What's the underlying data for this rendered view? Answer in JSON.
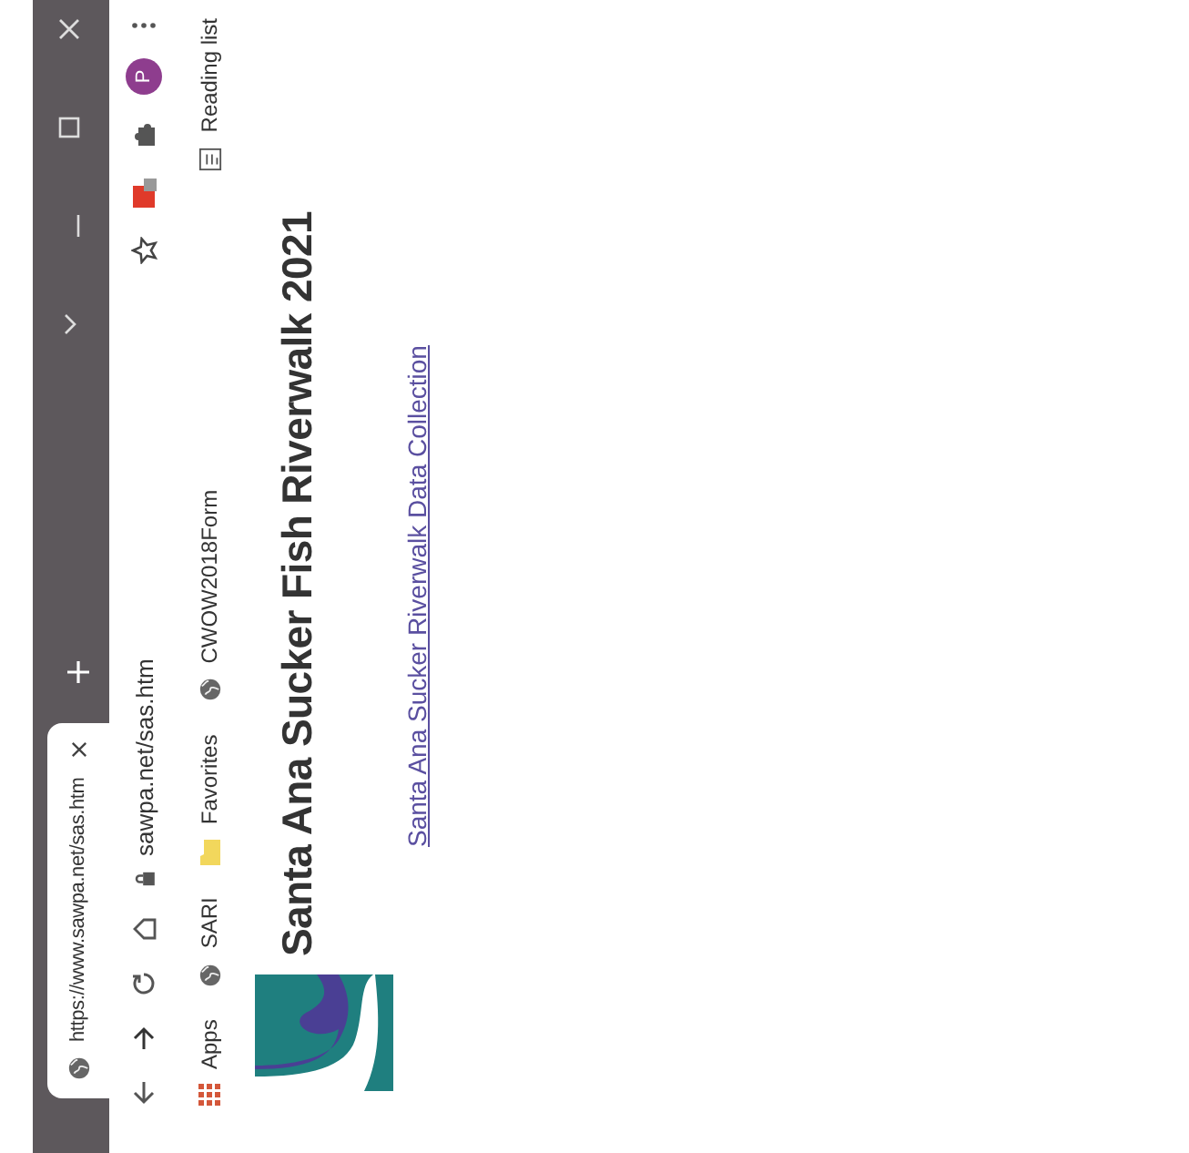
{
  "browser": {
    "tabs": [
      {
        "title": "https://www.sawpa.net/sas.htm",
        "selected": true
      }
    ],
    "address": "sawpa.net/sas.htm",
    "profile_initial": "P",
    "bookmarks": [
      {
        "label": "Apps",
        "kind": "apps"
      },
      {
        "label": "SARI",
        "kind": "site"
      },
      {
        "label": "Favorites",
        "kind": "folder"
      },
      {
        "label": "CWOW2018Form",
        "kind": "site"
      }
    ],
    "reading_list": "Reading list"
  },
  "page": {
    "heading": "Santa Ana Sucker Fish Riverwalk 2021",
    "link": "Santa Ana Sucker Riverwalk Data Collection"
  }
}
